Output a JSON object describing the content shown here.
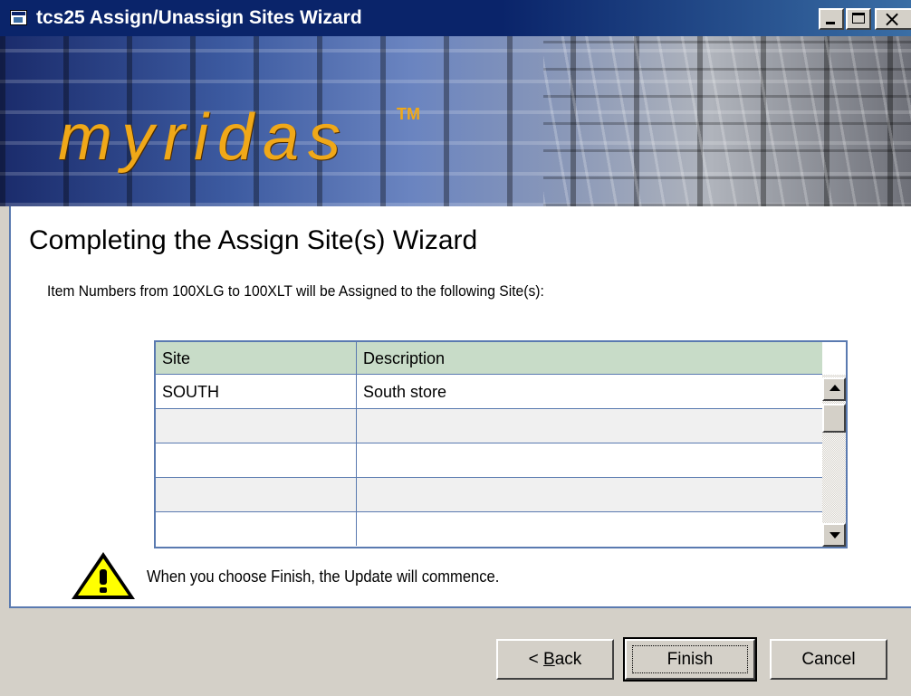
{
  "window": {
    "title": "tcs25 Assign/Unassign Sites Wizard",
    "controls": [
      "minimize-icon",
      "maximize-icon",
      "close-icon"
    ]
  },
  "banner": {
    "brand": "myridas",
    "trademark": "TM"
  },
  "page": {
    "heading": "Completing the Assign Site(s) Wizard",
    "intro": "Item Numbers from 100XLG to 100XLT will be Assigned to the following Site(s):"
  },
  "grid": {
    "columns": [
      "Site",
      "Description"
    ],
    "rows": [
      {
        "site": "SOUTH",
        "description": "South store"
      }
    ]
  },
  "warning": {
    "icon": "warning-icon",
    "text": "When you choose Finish, the Update will commence."
  },
  "buttons": {
    "back_prefix": "< ",
    "back_access": "B",
    "back_rest": "ack",
    "finish": "Finish",
    "cancel": "Cancel"
  },
  "colors": {
    "titlebar": "#0a246a",
    "brand": "#f0a818",
    "grid_header": "#c8dcc8",
    "grid_border": "#5a7ab0"
  }
}
